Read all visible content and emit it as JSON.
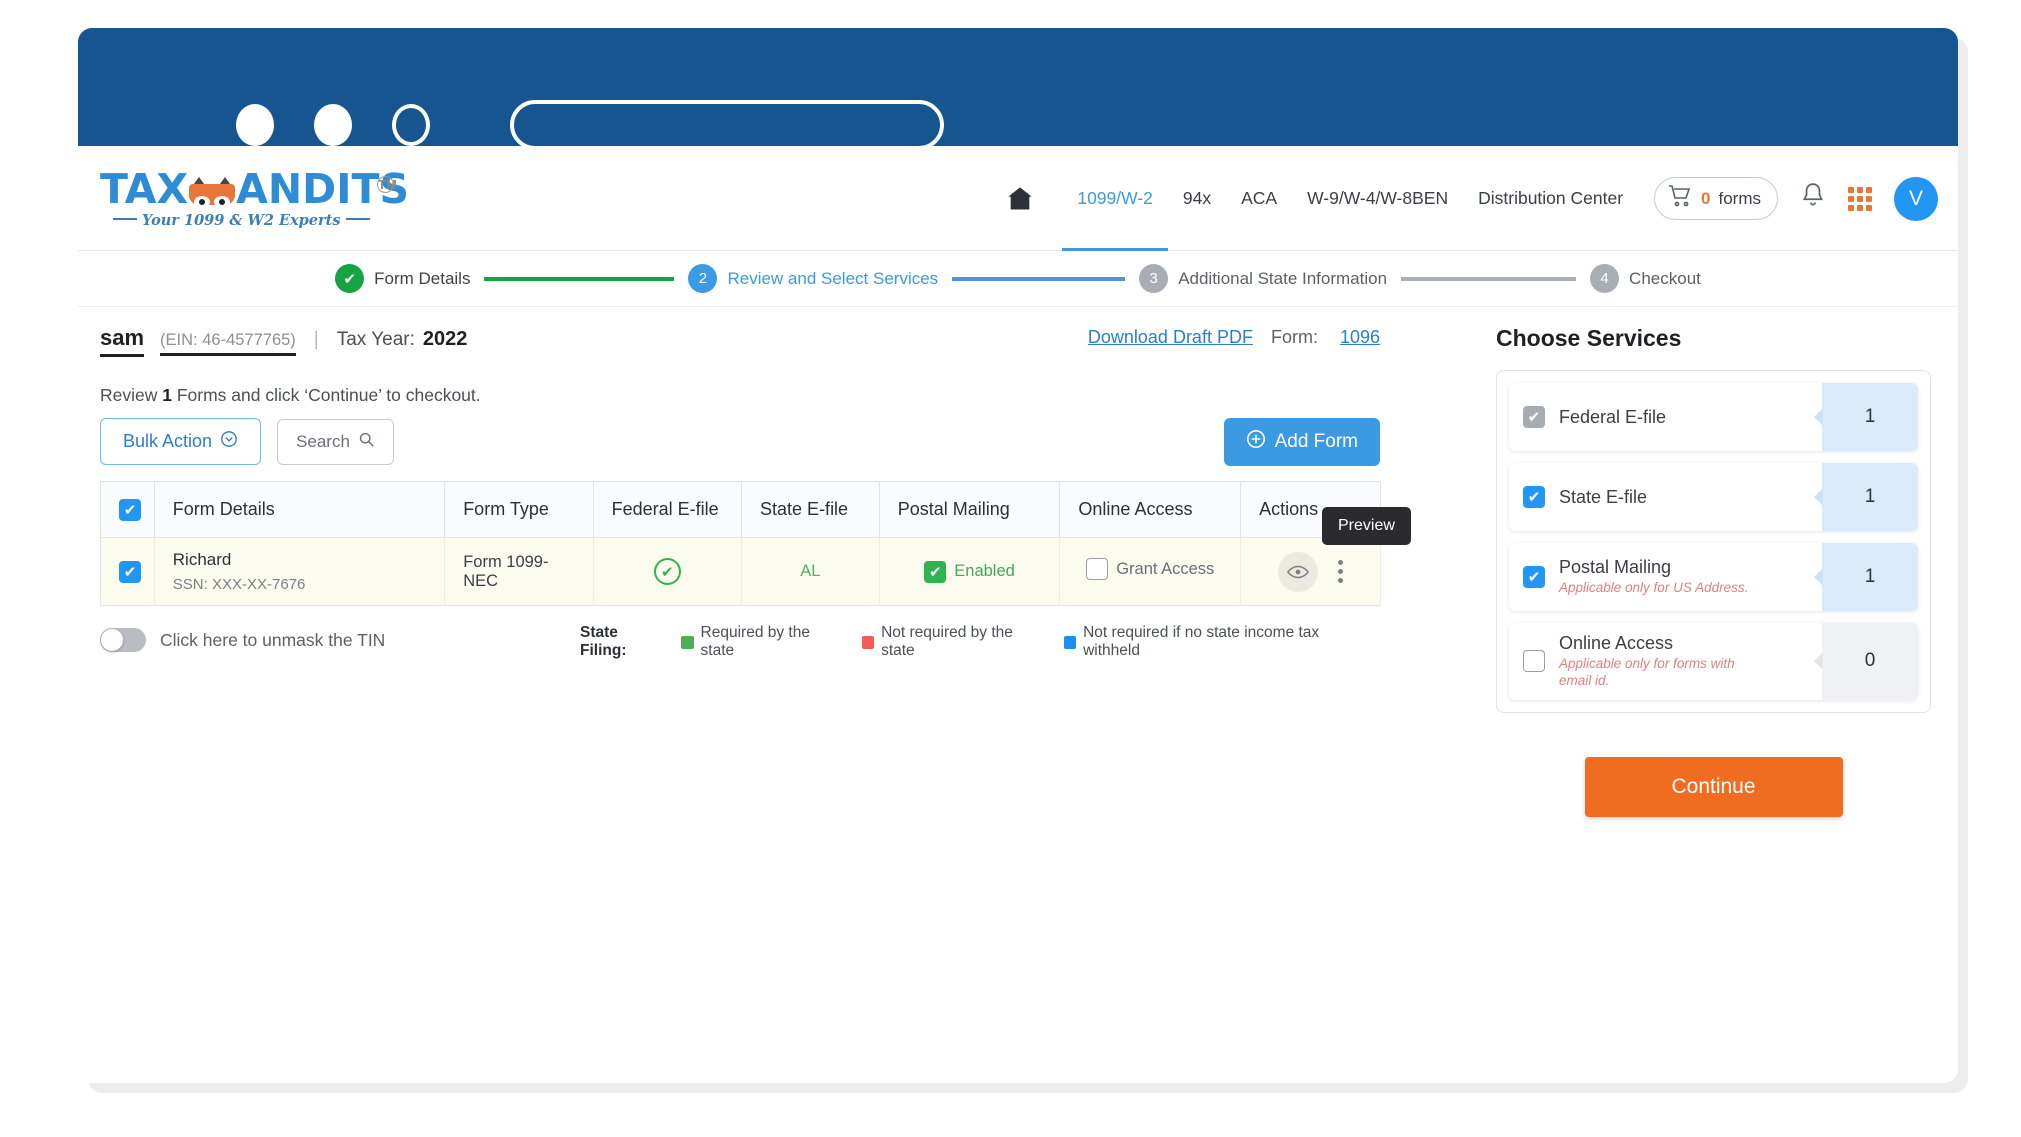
{
  "browser": {
    "window_controls": [
      "circle-filled",
      "circle-filled",
      "circle-outline"
    ],
    "address_bar_value": ""
  },
  "header": {
    "logo": {
      "text_part1": "TAX",
      "text_part2": "ANDITS",
      "trademark": "TM",
      "tagline": "Your 1099 & W2 Experts"
    },
    "nav": [
      {
        "label": "1099/W-2",
        "active": true
      },
      {
        "label": "94x",
        "active": false
      },
      {
        "label": "ACA",
        "active": false
      },
      {
        "label": "W-9/W-4/W-8BEN",
        "active": false
      },
      {
        "label": "Distribution Center",
        "active": false
      }
    ],
    "cart": {
      "count": "0",
      "label": "forms"
    },
    "avatar_initial": "V"
  },
  "stepper": {
    "steps": [
      {
        "num": "1",
        "label": "Form Details",
        "state": "done"
      },
      {
        "num": "2",
        "label": "Review and Select Services",
        "state": "active"
      },
      {
        "num": "3",
        "label": "Additional State Information",
        "state": "todo"
      },
      {
        "num": "4",
        "label": "Checkout",
        "state": "todo"
      }
    ]
  },
  "business": {
    "name": "sam",
    "ein": "(EIN: 46-4577765)",
    "separator": "|",
    "tax_year_label": "Tax Year:",
    "tax_year_value": "2022"
  },
  "links": {
    "download_draft_pdf": "Download Draft PDF",
    "form_label": "Form:",
    "form_value": "1096"
  },
  "review": {
    "text_before": "Review ",
    "count": "1",
    "text_after": " Forms and click ‘Continue’ to checkout."
  },
  "toolbar": {
    "bulk_action": "Bulk Action",
    "search_placeholder": "Search",
    "add_form": "Add Form"
  },
  "table": {
    "headers": {
      "form_details": "Form Details",
      "form_type": "Form Type",
      "federal_efile": "Federal E-file",
      "state_efile": "State E-file",
      "postal_mailing": "Postal Mailing",
      "online_access": "Online Access",
      "actions": "Actions"
    },
    "rows": [
      {
        "selected": true,
        "recipient_name": "Richard",
        "ssn": "SSN: XXX-XX-7676",
        "form_type": "Form 1099-NEC",
        "federal_efile": "check",
        "state_efile": "AL",
        "postal_mailing": "Enabled",
        "online_access": "Grant Access"
      }
    ],
    "tooltip": "Preview"
  },
  "tin_toggle": {
    "label": "Click here to unmask the TIN",
    "enabled": false
  },
  "state_filing_legend": {
    "title": "State Filing:",
    "items": [
      {
        "color": "#4caf50",
        "label": "Required by the state"
      },
      {
        "color": "#f45c5c",
        "label": "Not required by the state"
      },
      {
        "color": "#1e90f5",
        "label": "Not required if no state income tax withheld"
      }
    ]
  },
  "services": {
    "title": "Choose Services",
    "items": [
      {
        "name": "Federal E-file",
        "note": "",
        "checked": true,
        "disabled": true,
        "count": "1",
        "count_style": "blue"
      },
      {
        "name": "State E-file",
        "note": "",
        "checked": true,
        "disabled": false,
        "count": "1",
        "count_style": "blue"
      },
      {
        "name": "Postal Mailing",
        "note": "Applicable only for US Address.",
        "checked": true,
        "disabled": false,
        "count": "1",
        "count_style": "blue"
      },
      {
        "name": "Online Access",
        "note": "Applicable only for forms with email id.",
        "checked": false,
        "disabled": false,
        "count": "0",
        "count_style": "gray"
      }
    ],
    "continue_label": "Continue"
  },
  "colors": {
    "brand_blue": "#3b9ae1",
    "brand_orange": "#ef6c21",
    "titlebar": "#16558f",
    "green": "#17a344"
  }
}
